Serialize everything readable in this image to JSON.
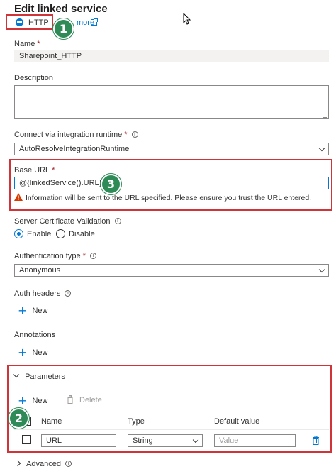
{
  "header": {
    "title": "Edit linked service",
    "connector_type": "HTTP",
    "learn_more": "more",
    "badges": [
      "1",
      "2",
      "3"
    ]
  },
  "name": {
    "label": "Name",
    "required": "*",
    "value": "Sharepoint_HTTP"
  },
  "description": {
    "label": "Description",
    "value": ""
  },
  "integration_runtime": {
    "label": "Connect via integration runtime",
    "required": "*",
    "value": "AutoResolveIntegrationRuntime"
  },
  "base_url": {
    "label": "Base URL",
    "required": "*",
    "value": "@{linkedService().URL}",
    "warning": "Information will be sent to the URL specified. Please ensure you trust the URL entered."
  },
  "cert_validation": {
    "label": "Server Certificate Validation",
    "options": [
      "Enable",
      "Disable"
    ],
    "selected": "Enable"
  },
  "auth_type": {
    "label": "Authentication type",
    "required": "*",
    "value": "Anonymous"
  },
  "auth_headers": {
    "label": "Auth headers",
    "new_label": "New"
  },
  "annotations": {
    "label": "Annotations",
    "new_label": "New"
  },
  "parameters": {
    "label": "Parameters",
    "new_label": "New",
    "delete_label": "Delete",
    "columns": [
      "Name",
      "Type",
      "Default value"
    ],
    "rows": [
      {
        "name": "URL",
        "type": "String",
        "default_placeholder": "Value"
      }
    ]
  },
  "advanced": {
    "label": "Advanced"
  },
  "colors": {
    "accent": "#0078d4",
    "highlight_box": "#d13438",
    "badge": "#2e8b57",
    "warning": "#d83b01"
  }
}
